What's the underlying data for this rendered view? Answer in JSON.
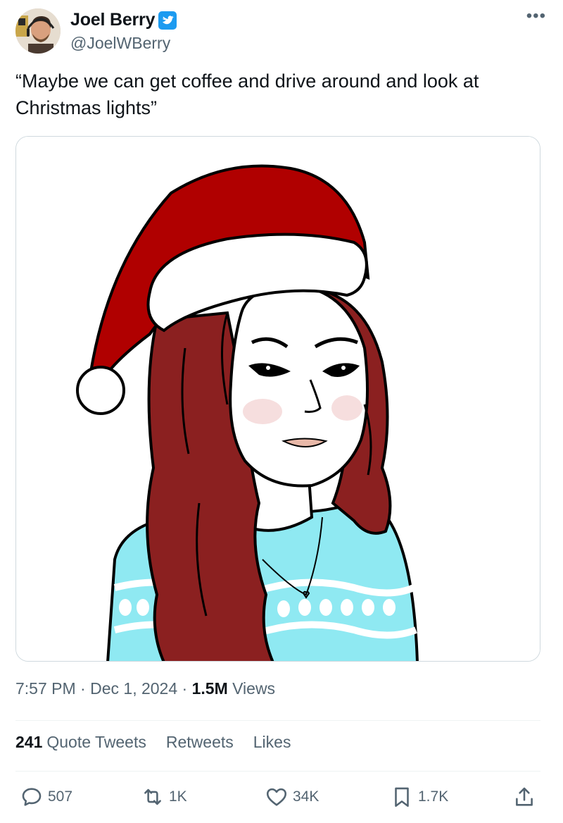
{
  "author": {
    "display_name": "Joel Berry",
    "handle": "@JoelWBerry",
    "verified": true,
    "avatar_icon": "avatar-photo"
  },
  "tweet": {
    "text": "“Maybe we can get coffee and drive around and look at Christmas lights”",
    "media_description_icon": "cartoon-woman-santa-hat-image"
  },
  "meta": {
    "time": "7:57 PM",
    "separator1": " · ",
    "date": "Dec 1, 2024",
    "separator2": " · ",
    "views_count": "1.5M",
    "views_label": " Views"
  },
  "stats": {
    "quote_count": "241",
    "quote_label": "Quote Tweets",
    "retweets_label": "Retweets",
    "likes_label": "Likes"
  },
  "actions": {
    "replies": "507",
    "retweets": "1K",
    "likes": "34K",
    "bookmarks": "1.7K"
  },
  "more_label": "•••",
  "colors": {
    "verified_blue": "#1d9bf0",
    "text_secondary": "#536471",
    "hat_red": "#b00000",
    "hair_red": "#8b2020",
    "sweater_blue": "#8fe9f2"
  }
}
